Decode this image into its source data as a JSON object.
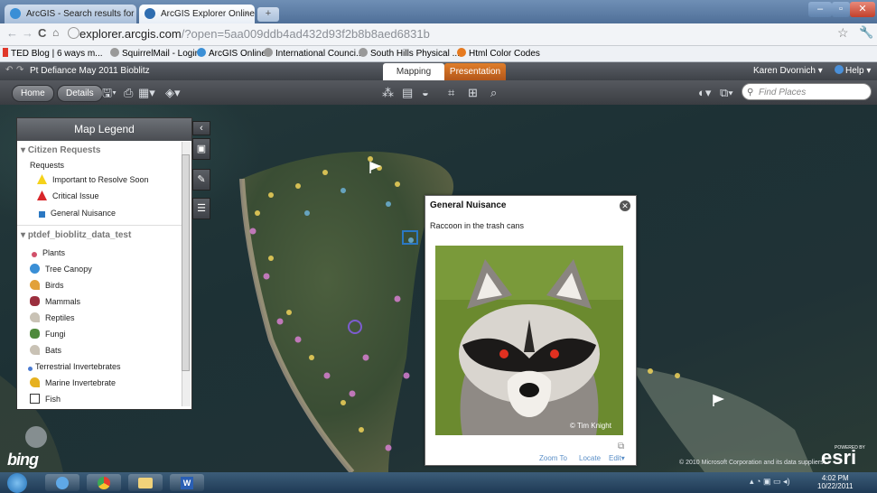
{
  "browser": {
    "tabs": [
      {
        "label": "ArcGIS - Search results for",
        "active": false
      },
      {
        "label": "ArcGIS Explorer Online",
        "active": true
      }
    ],
    "url_host": "explorer.arcgis.com",
    "url_path": "/?open=5aa009ddb4ad432d93f2b8b8aed6831b",
    "bookmarks": [
      "TED Blog | 6 ways m...",
      "SquirrelMail - Login",
      "ArcGIS Online",
      "International Counci...",
      "South Hills Physical ...",
      "Html Color Codes"
    ]
  },
  "app": {
    "title": "Pt Defiance May 2011 Bioblitz",
    "tabs": [
      "Mapping",
      "Presentation"
    ],
    "user": "Karen Dvornich",
    "help": "Help",
    "buttons": {
      "home": "Home",
      "details": "Details"
    },
    "search_placeholder": "Find Places"
  },
  "legend": {
    "title": "Map Legend",
    "sections": [
      {
        "name": "Citizen Requests",
        "sub": "Requests",
        "items": [
          {
            "label": "Important to Resolve Soon",
            "color": "#f5d21b",
            "icon": "warning-icon"
          },
          {
            "label": "Critical Issue",
            "color": "#d8262a",
            "icon": "alert-icon"
          },
          {
            "label": "General Nuisance",
            "color": "#2b78c2",
            "icon": "square-icon"
          }
        ]
      },
      {
        "name": "ptdef_bioblitz_data_test",
        "items": [
          {
            "label": "Plants",
            "color": "#d1516a",
            "icon": "plant-icon"
          },
          {
            "label": "Tree Canopy",
            "color": "#3a8fd6",
            "icon": "tree-icon"
          },
          {
            "label": "Birds",
            "color": "#e2a13a",
            "icon": "bird-icon"
          },
          {
            "label": "Mammals",
            "color": "#9b2f3e",
            "icon": "mammal-icon"
          },
          {
            "label": "Reptiles",
            "color": "#c9c2b5",
            "icon": "reptile-icon"
          },
          {
            "label": "Fungi",
            "color": "#4f8a3c",
            "icon": "fungi-icon"
          },
          {
            "label": "Bats",
            "color": "#c9c2b5",
            "icon": "bat-icon"
          },
          {
            "label": "Terrestrial Invertebrates",
            "color": "#4a7bd2",
            "icon": "dot-icon"
          },
          {
            "label": "Marine Invertebrate",
            "color": "#e6b11f",
            "icon": "marine-icon"
          },
          {
            "label": "Fish",
            "color": "#333333",
            "icon": "flag-icon"
          }
        ]
      }
    ]
  },
  "popup": {
    "title": "General Nuisance",
    "description": "Raccoon in the trash cans",
    "photo_credit": "© Tim Knight",
    "links": [
      "Zoom To",
      "Locate",
      "Edit"
    ]
  },
  "map": {
    "attribution": "© 2010 Microsoft Corporation and its data suppliers",
    "bing": "bing",
    "esri_powered": "POWERED BY",
    "esri": "esri"
  },
  "taskbar": {
    "time": "4:02 PM",
    "date": "10/22/2011"
  }
}
